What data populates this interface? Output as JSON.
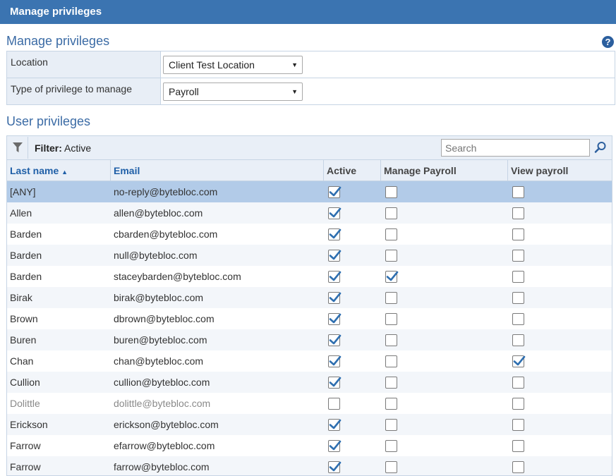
{
  "topbar": {
    "title": "Manage privileges"
  },
  "manage_section": {
    "title": "Manage privileges",
    "help_label": "?"
  },
  "form": {
    "location_label": "Location",
    "location_value": "Client Test Location",
    "privilege_label": "Type of privilege to manage",
    "privilege_value": "Payroll"
  },
  "user_section": {
    "title": "User privileges"
  },
  "toolbar": {
    "filter_label": "Filter:",
    "filter_value": "Active",
    "search_placeholder": "Search"
  },
  "columns": {
    "last_name": "Last name",
    "sort_arrow": "▲",
    "email": "Email",
    "active": "Active",
    "manage_payroll": "Manage Payroll",
    "view_payroll": "View payroll"
  },
  "rows": [
    {
      "last_name": "[ANY]",
      "email": "no-reply@bytebloc.com",
      "active": true,
      "manage": false,
      "view": false,
      "selected": true,
      "inactive": false
    },
    {
      "last_name": "Allen",
      "email": "allen@bytebloc.com",
      "active": true,
      "manage": false,
      "view": false,
      "selected": false,
      "inactive": false
    },
    {
      "last_name": "Barden",
      "email": "cbarden@bytebloc.com",
      "active": true,
      "manage": false,
      "view": false,
      "selected": false,
      "inactive": false
    },
    {
      "last_name": "Barden",
      "email": "null@bytebloc.com",
      "active": true,
      "manage": false,
      "view": false,
      "selected": false,
      "inactive": false
    },
    {
      "last_name": "Barden",
      "email": "staceybarden@bytebloc.com",
      "active": true,
      "manage": true,
      "view": false,
      "selected": false,
      "inactive": false
    },
    {
      "last_name": "Birak",
      "email": "birak@bytebloc.com",
      "active": true,
      "manage": false,
      "view": false,
      "selected": false,
      "inactive": false
    },
    {
      "last_name": "Brown",
      "email": "dbrown@bytebloc.com",
      "active": true,
      "manage": false,
      "view": false,
      "selected": false,
      "inactive": false
    },
    {
      "last_name": "Buren",
      "email": "buren@bytebloc.com",
      "active": true,
      "manage": false,
      "view": false,
      "selected": false,
      "inactive": false
    },
    {
      "last_name": "Chan",
      "email": "chan@bytebloc.com",
      "active": true,
      "manage": false,
      "view": true,
      "selected": false,
      "inactive": false
    },
    {
      "last_name": "Cullion",
      "email": "cullion@bytebloc.com",
      "active": true,
      "manage": false,
      "view": false,
      "selected": false,
      "inactive": false
    },
    {
      "last_name": "Dolittle",
      "email": "dolittle@bytebloc.com",
      "active": false,
      "manage": false,
      "view": false,
      "selected": false,
      "inactive": true
    },
    {
      "last_name": "Erickson",
      "email": "erickson@bytebloc.com",
      "active": true,
      "manage": false,
      "view": false,
      "selected": false,
      "inactive": false
    },
    {
      "last_name": "Farrow",
      "email": "efarrow@bytebloc.com",
      "active": true,
      "manage": false,
      "view": false,
      "selected": false,
      "inactive": false
    },
    {
      "last_name": "Farrow",
      "email": "farrow@bytebloc.com",
      "active": true,
      "manage": false,
      "view": false,
      "selected": false,
      "inactive": false
    }
  ],
  "colors": {
    "accent": "#3b74b1",
    "title_blue": "#3b6ba5",
    "selected_row": "#b2cbe8",
    "check": "#2f6fb0"
  },
  "icons": {
    "filter": "filter-icon",
    "search": "search-icon",
    "help": "help-icon",
    "dropdown": "chevron-down-icon",
    "check": "check-icon"
  }
}
